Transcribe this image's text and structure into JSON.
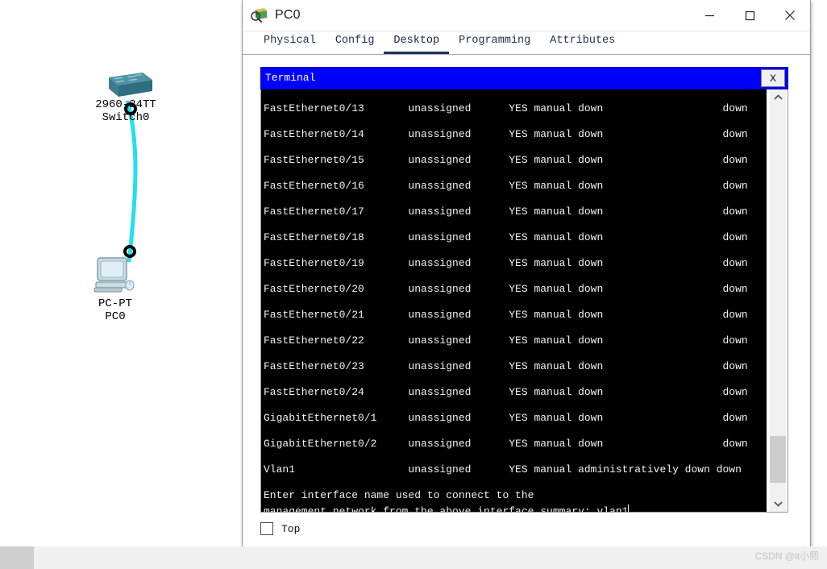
{
  "window": {
    "title": "PC0",
    "icon": "packet-tracer-device-icon",
    "controls": {
      "minimize": "—",
      "maximize": "□",
      "close": "✕"
    }
  },
  "tabs": [
    {
      "label": "Physical",
      "active": false
    },
    {
      "label": "Config",
      "active": false
    },
    {
      "label": "Desktop",
      "active": true
    },
    {
      "label": "Programming",
      "active": false
    },
    {
      "label": "Attributes",
      "active": false
    }
  ],
  "terminal": {
    "title": "Terminal",
    "close_label": "X",
    "colors": {
      "titlebar": "#0000FF",
      "screen_bg": "#000000",
      "screen_fg": "#F2F2F2"
    },
    "lines": [
      "FastEthernet0/13       unassigned      YES manual down                   down",
      "FastEthernet0/14       unassigned      YES manual down                   down",
      "FastEthernet0/15       unassigned      YES manual down                   down",
      "FastEthernet0/16       unassigned      YES manual down                   down",
      "FastEthernet0/17       unassigned      YES manual down                   down",
      "FastEthernet0/18       unassigned      YES manual down                   down",
      "FastEthernet0/19       unassigned      YES manual down                   down",
      "FastEthernet0/20       unassigned      YES manual down                   down",
      "FastEthernet0/21       unassigned      YES manual down                   down",
      "FastEthernet0/22       unassigned      YES manual down                   down",
      "FastEthernet0/23       unassigned      YES manual down                   down",
      "FastEthernet0/24       unassigned      YES manual down                   down",
      "GigabitEthernet0/1     unassigned      YES manual down                   down",
      "GigabitEthernet0/2     unassigned      YES manual down                   down",
      "Vlan1                  unassigned      YES manual administratively down down"
    ],
    "prompt_line_1": "Enter interface name used to connect to the",
    "prompt_line_2": "management network from the above interface summary: vlan1",
    "scrollbar": {
      "up_arrow": "⌃",
      "down_arrow": "⌄"
    }
  },
  "bottom": {
    "top_checkbox_label": "Top",
    "top_checkbox_checked": false
  },
  "topology": {
    "switch": {
      "model": "2960-24TT",
      "name": "Switch0",
      "icon": "network-switch-icon"
    },
    "pc": {
      "model": "PC-PT",
      "name": "PC0",
      "icon": "desktop-computer-icon"
    },
    "cable_color": "#22E0F0"
  },
  "watermark": "CSDN @it小熙"
}
